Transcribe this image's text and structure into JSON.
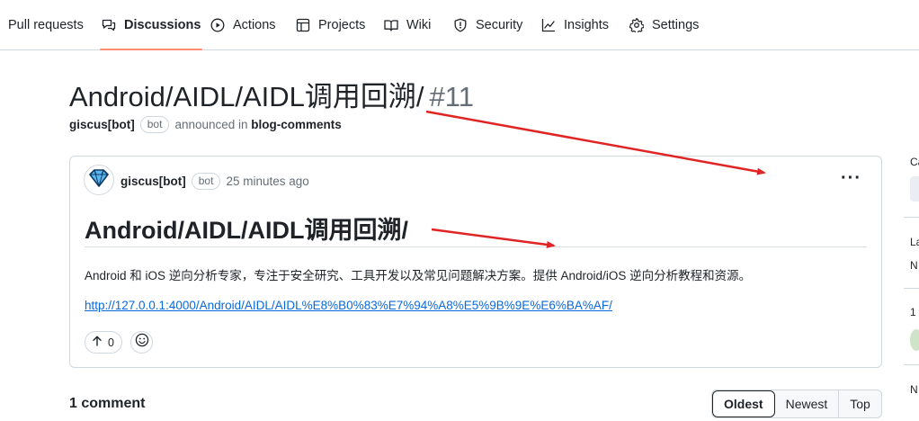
{
  "nav": {
    "tabs": [
      {
        "label": "Pull requests",
        "icon": "none"
      },
      {
        "label": "Discussions",
        "icon": "comment-discussion-icon",
        "active": true
      },
      {
        "label": "Actions",
        "icon": "play-icon"
      },
      {
        "label": "Projects",
        "icon": "table-icon"
      },
      {
        "label": "Wiki",
        "icon": "book-icon"
      },
      {
        "label": "Security",
        "icon": "shield-icon"
      },
      {
        "label": "Insights",
        "icon": "graph-icon"
      },
      {
        "label": "Settings",
        "icon": "gear-icon"
      }
    ],
    "active_underline_color": "#fd8c73"
  },
  "discussion": {
    "title": "Android/AIDL/AIDL调用回溯/",
    "number": "#11",
    "author": "giscus[bot]",
    "author_badge": "bot",
    "announced_text": "announced in",
    "category": "blog-comments"
  },
  "post": {
    "author": "giscus[bot]",
    "author_badge": "bot",
    "time": "25 minutes ago",
    "more_label": "···",
    "heading": "Android/AIDL/AIDL调用回溯/",
    "body": "Android 和 iOS 逆向分析专家，专注于安全研究、工具开发以及常见问题解决方案。提供 Android/iOS 逆向分析教程和资源。",
    "link": "http://127.0.0.1:4000/Android/AIDL/AIDL%E8%B0%83%E7%94%A8%E5%9B%9E%E6%BA%AF/",
    "upvotes": "0"
  },
  "comments": {
    "count_label": "1 comment",
    "sort_options": [
      "Oldest",
      "Newest",
      "Top"
    ],
    "selected": "Oldest"
  },
  "sidebar": {
    "labels": [
      "Ca",
      "La",
      "N",
      "1",
      "N"
    ]
  },
  "annotation_color": "#e02424"
}
